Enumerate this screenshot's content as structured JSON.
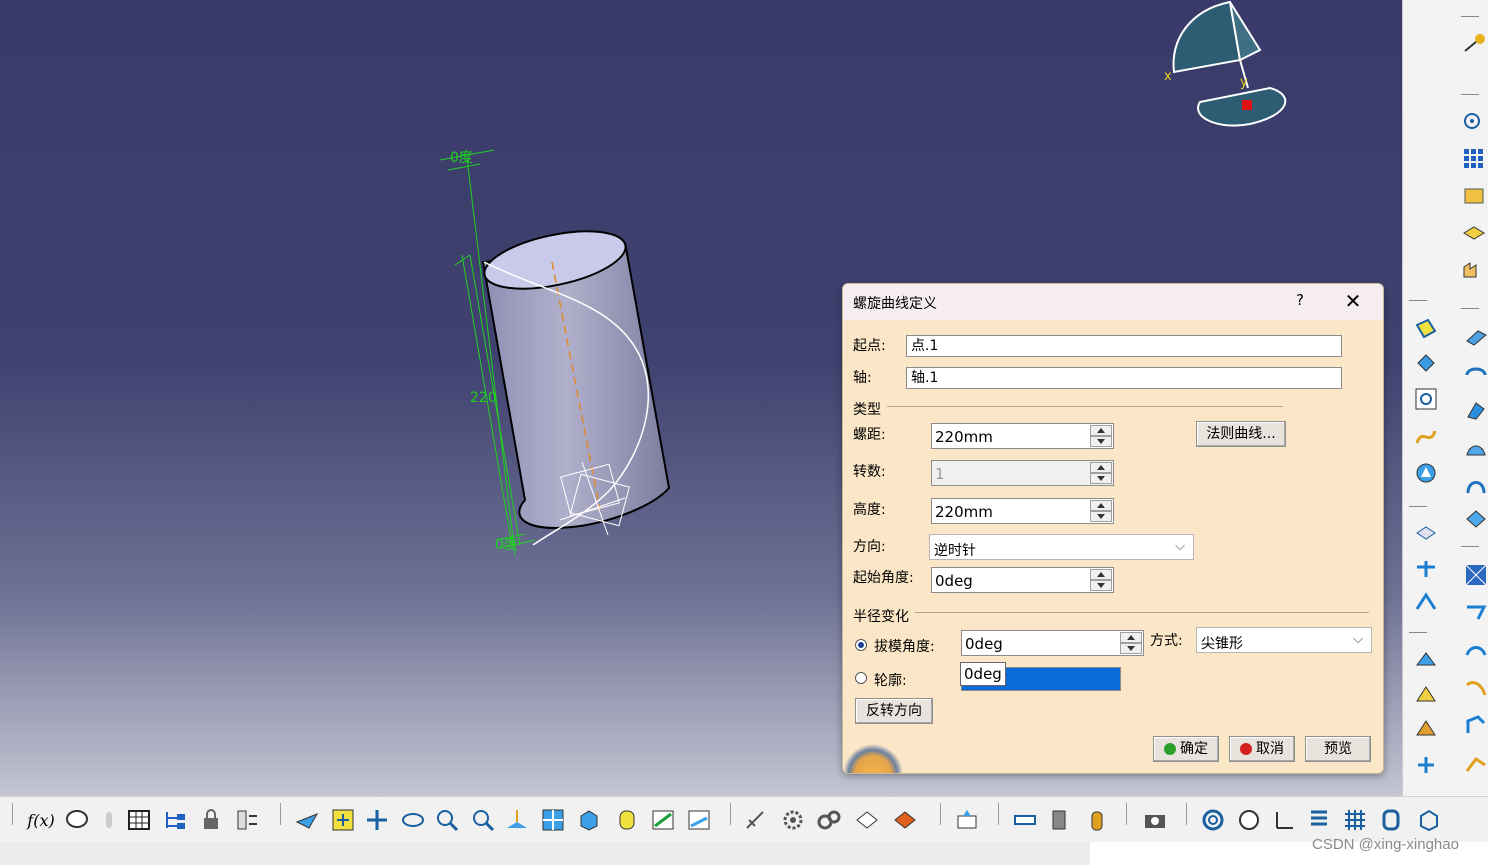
{
  "viewport": {
    "dimension_top": "0度",
    "dimension_length": "220",
    "dimension_bottom": "0度",
    "compass_x": "x",
    "compass_y": "y"
  },
  "dialog": {
    "title": "螺旋曲线定义",
    "help": "?",
    "close": "✕",
    "start_point_label": "起点:",
    "start_point_value": "点.1",
    "axis_label": "轴:",
    "axis_value": "轴.1",
    "type_group": "类型",
    "pitch_label": "螺距:",
    "pitch_value": "220mm",
    "law_button": "法则曲线...",
    "turns_label": "转数:",
    "turns_value": "1",
    "height_label": "高度:",
    "height_value": "220mm",
    "direction_label": "方向:",
    "direction_value": "逆时针",
    "start_angle_label": "起始角度:",
    "start_angle_value": "0deg",
    "radius_group": "半径变化",
    "draft_angle_label": "拔模角度:",
    "draft_angle_value": "0deg",
    "mode_label": "方式:",
    "mode_value": "尖锥形",
    "profile_label": "轮廓:",
    "profile_tooltip": "0deg",
    "reverse_button": "反转方向",
    "ok_button": "确定",
    "cancel_button": "取消",
    "preview_button": "预览"
  },
  "colors": {
    "dialog_bg": "#fbe7c7",
    "ok_dot": "#2aa02a",
    "cancel_dot": "#d42020",
    "selection": "#0a6ad8",
    "dimension_green": "#1fd21f"
  },
  "status": {
    "watermark": "CSDN @xing-xinghao"
  }
}
